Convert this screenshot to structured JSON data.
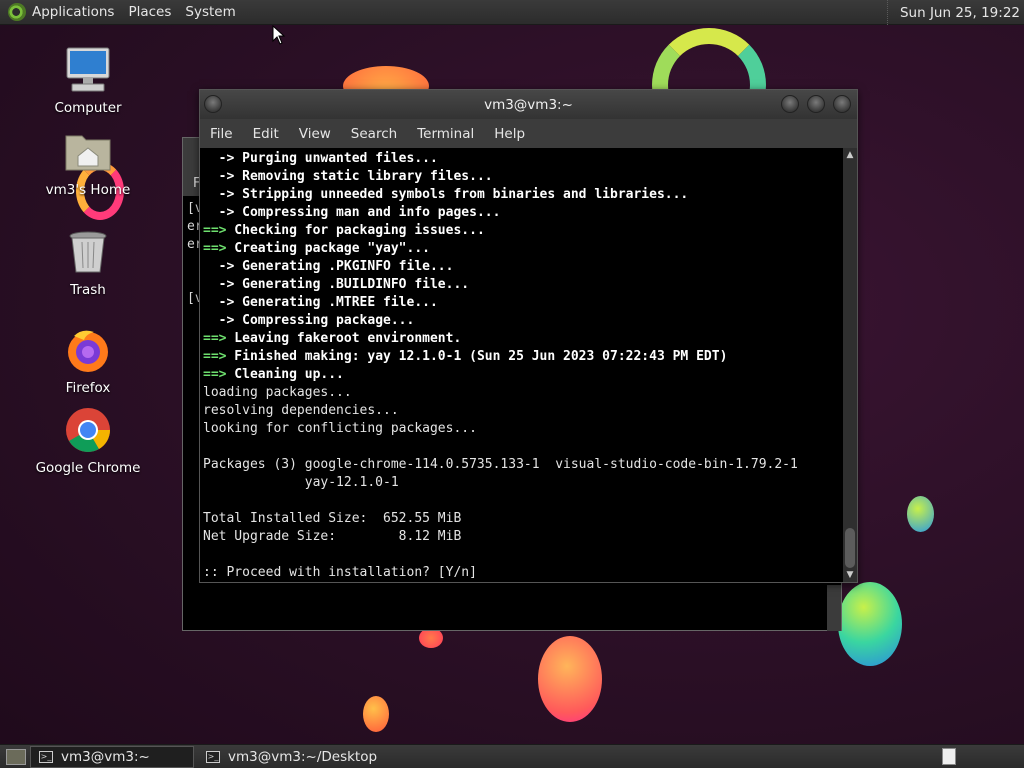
{
  "top_panel": {
    "menus": [
      "Applications",
      "Places",
      "System"
    ],
    "clock": "Sun Jun 25, 19:22"
  },
  "desktop_icons": [
    {
      "label": "Computer",
      "icon": "computer-icon"
    },
    {
      "label": "vm3's Home",
      "icon": "home-folder-icon"
    },
    {
      "label": "Trash",
      "icon": "trash-icon"
    },
    {
      "label": "Firefox",
      "icon": "firefox-icon"
    },
    {
      "label": "Google Chrome",
      "icon": "chrome-icon"
    }
  ],
  "terminal_window": {
    "title": "vm3@vm3:~",
    "menus": [
      "File",
      "Edit",
      "View",
      "Search",
      "Terminal",
      "Help"
    ],
    "lines": [
      {
        "prefix": "  ->",
        "text": " Purging unwanted files...",
        "kind": "sub"
      },
      {
        "prefix": "  ->",
        "text": " Removing static library files...",
        "kind": "sub"
      },
      {
        "prefix": "  ->",
        "text": " Stripping unneeded symbols from binaries and libraries...",
        "kind": "sub"
      },
      {
        "prefix": "  ->",
        "text": " Compressing man and info pages...",
        "kind": "sub"
      },
      {
        "prefix": "==>",
        "text": " Checking for packaging issues...",
        "kind": "main"
      },
      {
        "prefix": "==>",
        "text": " Creating package \"yay\"...",
        "kind": "main"
      },
      {
        "prefix": "  ->",
        "text": " Generating .PKGINFO file...",
        "kind": "sub"
      },
      {
        "prefix": "  ->",
        "text": " Generating .BUILDINFO file...",
        "kind": "sub"
      },
      {
        "prefix": "  ->",
        "text": " Generating .MTREE file...",
        "kind": "sub"
      },
      {
        "prefix": "  ->",
        "text": " Compressing package...",
        "kind": "sub"
      },
      {
        "prefix": "==>",
        "text": " Leaving fakeroot environment.",
        "kind": "main"
      },
      {
        "prefix": "==>",
        "text": " Finished making: yay 12.1.0-1 (Sun 25 Jun 2023 07:22:43 PM EDT)",
        "kind": "main"
      },
      {
        "prefix": "==>",
        "text": " Cleaning up...",
        "kind": "main"
      },
      {
        "prefix": "",
        "text": "loading packages...",
        "kind": "plain"
      },
      {
        "prefix": "",
        "text": "resolving dependencies...",
        "kind": "plain"
      },
      {
        "prefix": "",
        "text": "looking for conflicting packages...",
        "kind": "plain"
      },
      {
        "prefix": "",
        "text": "",
        "kind": "plain"
      },
      {
        "prefix": "",
        "text": "Packages (3) google-chrome-114.0.5735.133-1  visual-studio-code-bin-1.79.2-1",
        "kind": "plain"
      },
      {
        "prefix": "",
        "text": "             yay-12.1.0-1",
        "kind": "plain"
      },
      {
        "prefix": "",
        "text": "",
        "kind": "plain"
      },
      {
        "prefix": "",
        "text": "Total Installed Size:  652.55 MiB",
        "kind": "plain"
      },
      {
        "prefix": "",
        "text": "Net Upgrade Size:        8.12 MiB",
        "kind": "plain"
      },
      {
        "prefix": "",
        "text": "",
        "kind": "plain"
      },
      {
        "prefix": "",
        "text": ":: Proceed with installation? [Y/n]",
        "kind": "plain"
      }
    ]
  },
  "back_window": {
    "menu_fragment": "F",
    "lines": [
      "[v",
      "er",
      "er",
      "",
      "",
      "[v"
    ]
  },
  "taskbar": {
    "tasks": [
      "vm3@vm3:~",
      "vm3@vm3:~/Desktop"
    ]
  },
  "colors": {
    "arrow_sub": "#50c0ff",
    "arrow_main": "#6ee06e",
    "terminal_bg": "#000000"
  }
}
